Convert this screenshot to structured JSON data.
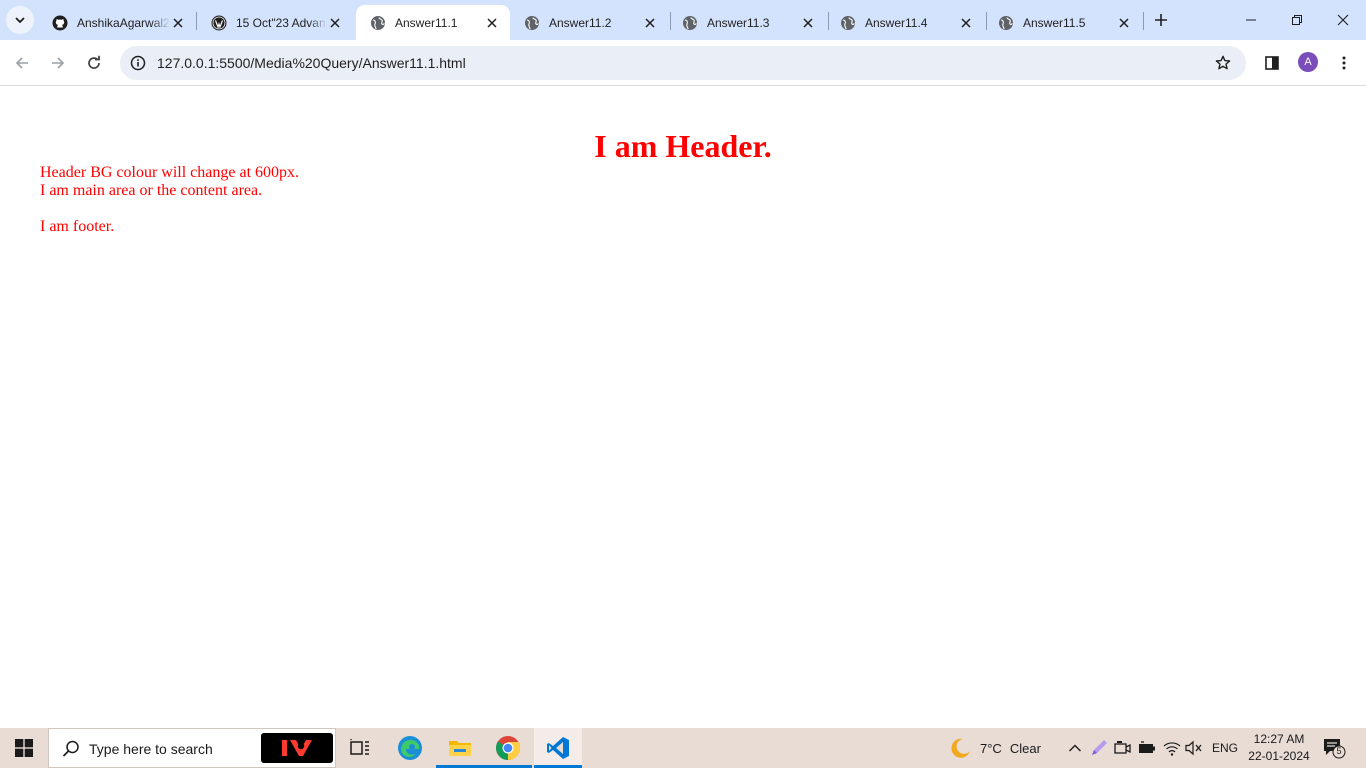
{
  "browser": {
    "tabs": [
      {
        "title": "AnshikaAgarwal2",
        "favicon": "github-icon",
        "active": false
      },
      {
        "title": "15 Oct\"23 Advan",
        "favicon": "wordpress-icon",
        "active": false
      },
      {
        "title": "Answer11.1",
        "favicon": "globe-icon",
        "active": true
      },
      {
        "title": "Answer11.2",
        "favicon": "globe-icon",
        "active": false
      },
      {
        "title": "Answer11.3",
        "favicon": "globe-icon",
        "active": false
      },
      {
        "title": "Answer11.4",
        "favicon": "globe-icon",
        "active": false
      },
      {
        "title": "Answer11.5",
        "favicon": "globe-icon",
        "active": false
      }
    ],
    "url": "127.0.0.1:5500/Media%20Query/Answer11.1.html",
    "profile_initial": "A"
  },
  "page": {
    "header": "I am Header.",
    "header_note": "Header BG colour will change at 600px.",
    "main": "I am main area or the content area.",
    "footer": "I am footer.",
    "text_color": "#ff0000"
  },
  "taskbar": {
    "search_placeholder": "Type here to search",
    "apps": [
      "iv-app-icon",
      "task-view-icon",
      "edge-icon",
      "file-explorer-icon",
      "chrome-icon",
      "vscode-icon"
    ],
    "weather": {
      "temp": "7°C",
      "condition": "Clear"
    },
    "language": "ENG",
    "time": "12:27 AM",
    "date": "22-01-2024",
    "notification_count": "5"
  }
}
